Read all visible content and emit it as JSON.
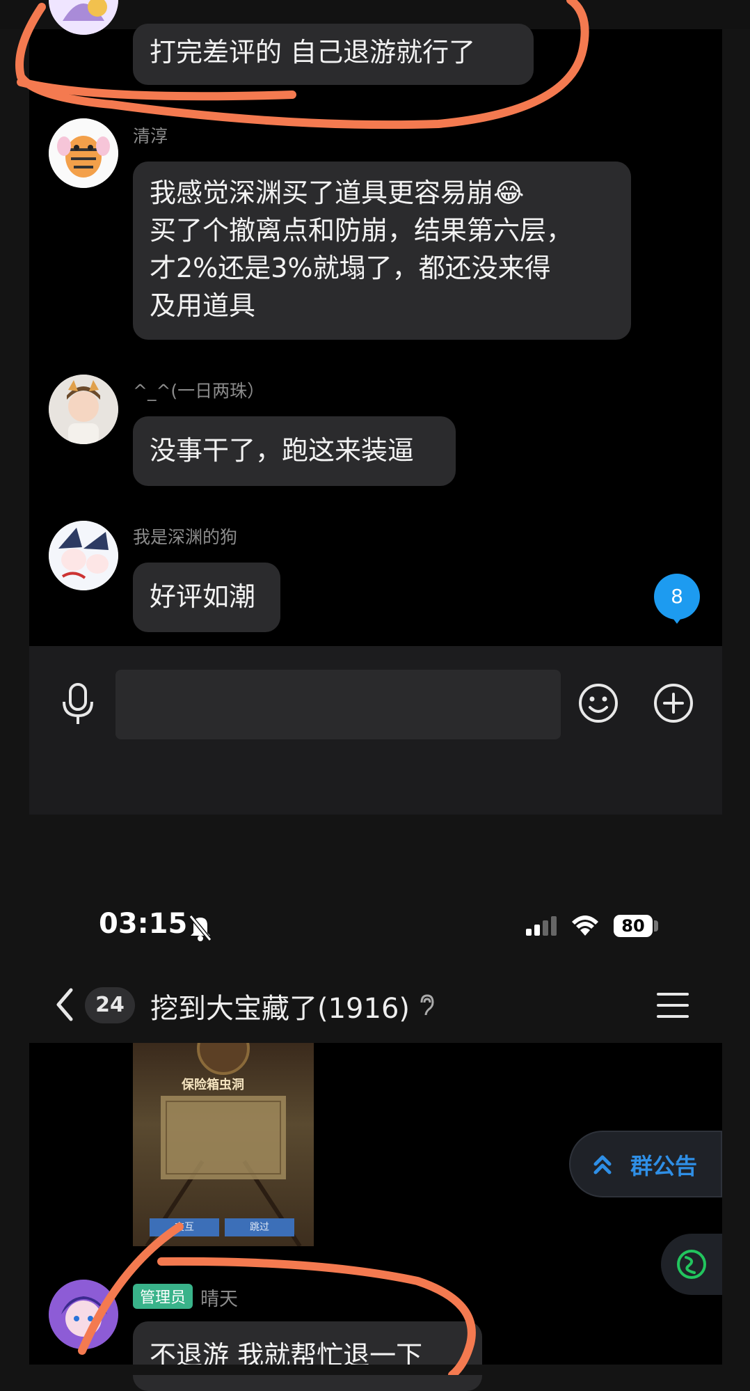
{
  "chat_top": {
    "messages": [
      {
        "name": "",
        "lines": [
          "打完差评的 自己退游就行了"
        ]
      },
      {
        "name": "清淳",
        "lines": [
          "我感觉深渊买了道具更容易崩",
          "买了个撤离点和防崩，结果第六层，",
          "才2%还是3%就塌了，都还没来得",
          "及用道具"
        ],
        "emoji": "😂"
      },
      {
        "name": "^_^(一日两珠）",
        "lines": [
          "没事干了，跑这来装逼"
        ]
      },
      {
        "name": "我是深渊的狗",
        "lines": [
          "好评如潮"
        ]
      }
    ],
    "unread_badge": "8"
  },
  "input_bar": {
    "placeholder": "",
    "icons": [
      "microphone-icon",
      "emoji-icon",
      "plus-icon"
    ]
  },
  "status_bar": {
    "time": "03:15",
    "battery": "80"
  },
  "header": {
    "back_count": "24",
    "title": "挖到大宝藏了(1916)"
  },
  "chat_bottom": {
    "image_card": {
      "title": "保险箱虫洞",
      "button_left": "交互",
      "button_right": "跳过"
    },
    "notice_label": "群公告",
    "last_message": {
      "tag": "管理员",
      "name": "晴天",
      "text": "不退游 我就帮忙退一下"
    }
  },
  "colors": {
    "bubble": "#2b2b2d",
    "accent_blue": "#1d9bf0",
    "admin_green": "#39b38a",
    "annotation_orange": "#f47a50"
  }
}
